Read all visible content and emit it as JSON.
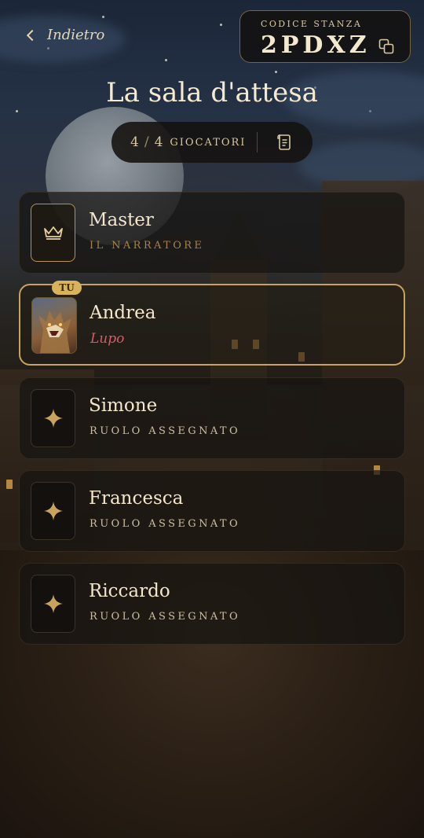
{
  "header": {
    "back_label": "Indietro",
    "room_caption": "CODICE STANZA",
    "room_code": "2PDXZ"
  },
  "page_title": "La sala d'attesa",
  "players_pill": {
    "current": "4",
    "separator": "/",
    "total": "4",
    "label": "GIOCATORI"
  },
  "players": [
    {
      "name": "Master",
      "subtitle": "IL NARRATORE",
      "icon": "crown-icon"
    },
    {
      "name": "Andrea",
      "subtitle": "Lupo",
      "badge": "TU",
      "icon": "werewolf-avatar"
    },
    {
      "name": "Simone",
      "subtitle": "RUOLO ASSEGNATO",
      "icon": "sparkle-icon"
    },
    {
      "name": "Francesca",
      "subtitle": "RUOLO ASSEGNATO",
      "icon": "sparkle-icon"
    },
    {
      "name": "Riccardo",
      "subtitle": "RUOLO ASSEGNATO",
      "icon": "sparkle-icon"
    }
  ],
  "colors": {
    "accent_gold": "#c9a35d",
    "role_red": "#d55c6a",
    "text_light": "#f3e6cc"
  }
}
